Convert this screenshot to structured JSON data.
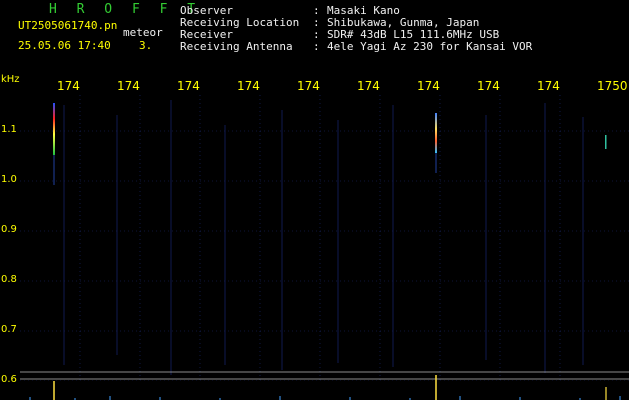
{
  "header": {
    "title": "H R O F F T",
    "file_name": "UT2505061740.pn",
    "meteor_label": "meteor",
    "datetime": "25.05.06 17:40",
    "meteor_count": "3."
  },
  "info": [
    {
      "key": "Observer",
      "value": "Masaki Kano"
    },
    {
      "key": "Receiving Location",
      "value": "Shibukawa, Gunma, Japan"
    },
    {
      "key": "Receiver",
      "value": "SDR# 43dB L15 111.6MHz USB"
    },
    {
      "key": "Receiving Antenna",
      "value": "4ele Yagi Az 230 for Kansai VOR"
    }
  ],
  "info_colon": ":",
  "axis": {
    "unit": "kHz",
    "time_ticks": [
      "174",
      "174",
      "174",
      "174",
      "174",
      "174",
      "174",
      "174",
      "174",
      "1750"
    ],
    "freq_ticks": [
      "1.1",
      "1.0",
      "0.9",
      "0.8",
      "0.7",
      "0.6"
    ]
  },
  "colors": {
    "title": "#33cc33",
    "text": "#f0f0f0",
    "axis": "#ffff00",
    "grid": "#1c2a70",
    "background": "#000000"
  }
}
